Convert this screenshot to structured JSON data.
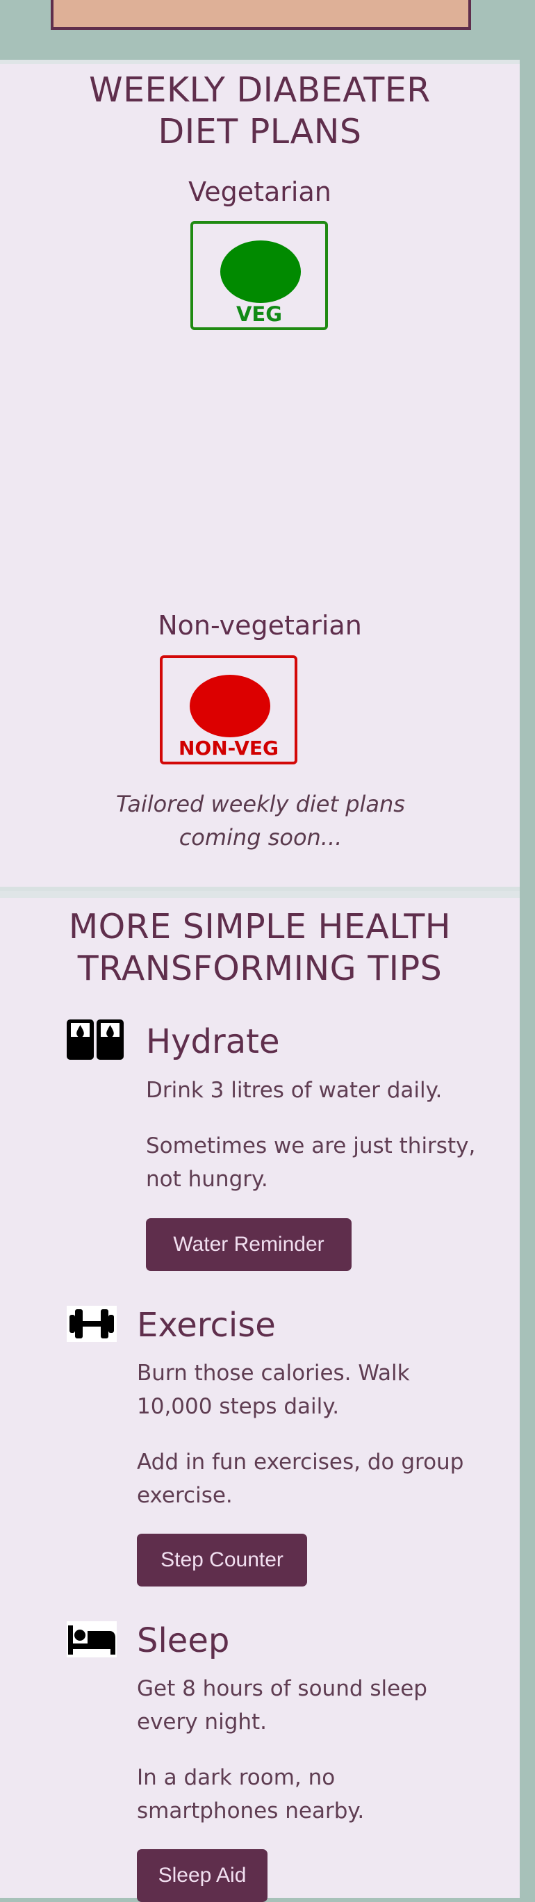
{
  "diet": {
    "title_line1": "WEEKLY DIABEATER",
    "title_line2": "DIET PLANS",
    "vegetarian_heading": "Vegetarian",
    "veg_badge_label": "VEG",
    "nonveg_heading": "Non-vegetarian",
    "nonveg_badge_label": "NON-VEG",
    "coming_soon": "Tailored weekly diet plans coming soon..."
  },
  "tips": {
    "title_line1": "MORE SIMPLE HEALTH",
    "title_line2": "TRANSFORMING TIPS",
    "items": [
      {
        "icon": "water-glasses-icon",
        "title": "Hydrate",
        "text1": "Drink 3 litres of water daily.",
        "text2_line1": "Sometimes we are just thirsty,",
        "text2_line2": "not hungry.",
        "button": "Water Reminder"
      },
      {
        "icon": "dumbbell-icon",
        "title": "Exercise",
        "text1_line1": "Burn those calories. Walk",
        "text1_line2": "10,000 steps daily.",
        "text2_line1": "Add in fun exercises, do group",
        "text2_line2": "exercise.",
        "button": "Step Counter"
      },
      {
        "icon": "bed-icon",
        "title": "Sleep",
        "text1_line1": "Get 8 hours of sound sleep",
        "text1_line2": "every night.",
        "text2_line1": "In a dark room, no",
        "text2_line2": "smartphones nearby.",
        "button": "Sleep Aid"
      }
    ]
  },
  "colors": {
    "page_bg": "#a7c1b9",
    "panel_bg": "#efe8f2",
    "primary": "#5f2e4c",
    "veg_green": "#018a00",
    "nonveg_red": "#dc0000",
    "top_box": "#deb097"
  }
}
